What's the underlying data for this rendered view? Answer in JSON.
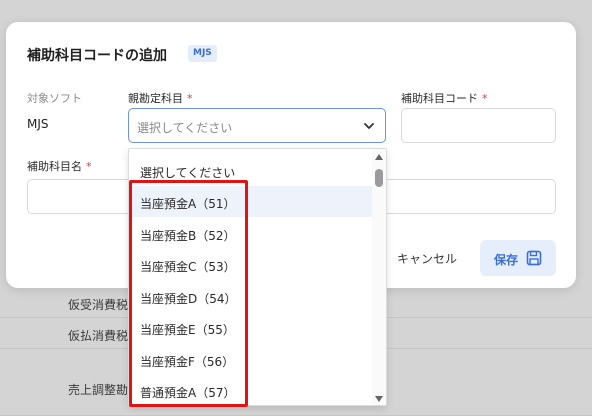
{
  "background_rows": [
    "仮受消費税",
    "仮払消費税",
    "売上調整勘"
  ],
  "dialog": {
    "title": "補助科目コードの追加",
    "badge": "MJS",
    "target_software_label": "対象ソフト",
    "target_software_value": "MJS",
    "parent_account_label": "親勘定科目",
    "parent_account_placeholder": "選択してください",
    "sub_code_label": "補助科目コード",
    "sub_name_label": "補助科目名",
    "required_mark": "*",
    "cancel_label": "キャンセル",
    "save_label": "保存"
  },
  "dropdown": {
    "options": [
      "選択してください",
      "当座預金A（51）",
      "当座預金B（52）",
      "当座預金C（53）",
      "当座預金D（54）",
      "当座預金E（55）",
      "当座預金F（56）",
      "普通預金A（57）"
    ],
    "hovered_option": "当座預金A（51）"
  },
  "colors": {
    "accent": "#3a6fd8",
    "required": "#e23b3b",
    "highlight": "#e01414"
  },
  "icons": {
    "select_chevron": "chevron-down-icon",
    "save": "floppy-disk-icon",
    "scroll_up": "scroll-up-arrow-icon",
    "scroll_down": "scroll-down-arrow-icon"
  }
}
